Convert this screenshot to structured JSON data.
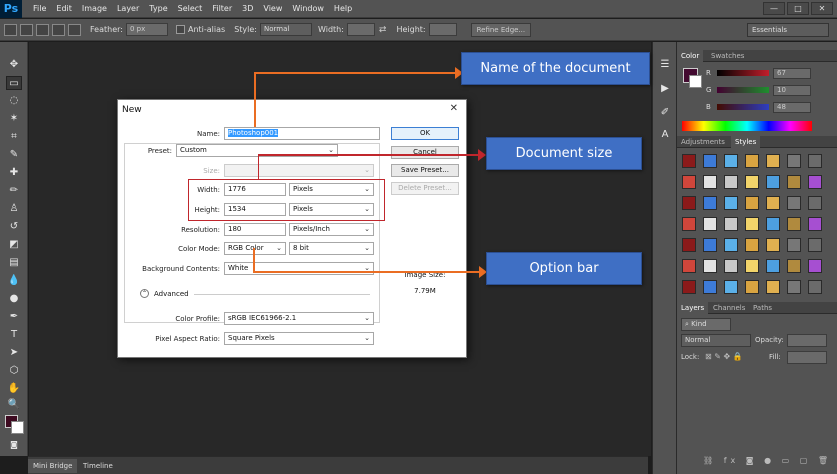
{
  "app": {
    "logo": "Ps",
    "menus": [
      "File",
      "Edit",
      "Image",
      "Layer",
      "Type",
      "Select",
      "Filter",
      "3D",
      "View",
      "Window",
      "Help"
    ],
    "window_controls": [
      "—",
      "□",
      "✕"
    ]
  },
  "options_bar": {
    "feather_label": "Feather:",
    "feather_value": "0 px",
    "antialias_label": "Anti-alias",
    "style_label": "Style:",
    "style_value": "Normal",
    "width_label": "Width:",
    "height_label": "Height:",
    "refine_label": "Refine Edge...",
    "workspace": "Essentials"
  },
  "bottom_tabs": [
    "Mini Bridge",
    "Timeline"
  ],
  "color_panel": {
    "tabs": [
      "Color",
      "Swatches"
    ],
    "channels": [
      {
        "label": "R",
        "value": "67",
        "color": "#c21e2b"
      },
      {
        "label": "G",
        "value": "10",
        "color": "#1e8f2e"
      },
      {
        "label": "B",
        "value": "48",
        "color": "#2d3ec1"
      }
    ],
    "fg": "#430a30"
  },
  "styles_panel": {
    "tabs": [
      "Adjustments",
      "Styles"
    ]
  },
  "layers_panel": {
    "tabs": [
      "Layers",
      "Channels",
      "Paths"
    ],
    "kind_label": "Kind",
    "blend_mode": "Normal",
    "opacity_label": "Opacity:",
    "lock_label": "Lock:",
    "fill_label": "Fill:"
  },
  "dialog": {
    "title": "New",
    "close": "✕",
    "name_label": "Name:",
    "name_value": "Photoshop001",
    "preset_label": "Preset:",
    "preset_value": "Custom",
    "size_label": "Size:",
    "width_label": "Width:",
    "width_value": "1776",
    "width_unit": "Pixels",
    "height_label": "Height:",
    "height_value": "1534",
    "height_unit": "Pixels",
    "resolution_label": "Resolution:",
    "resolution_value": "180",
    "resolution_unit": "Pixels/Inch",
    "color_mode_label": "Color Mode:",
    "color_mode_value": "RGB Color",
    "bit_depth": "8 bit",
    "bg_label": "Background Contents:",
    "bg_value": "White",
    "advanced_label": "Advanced",
    "profile_label": "Color Profile:",
    "profile_value": "sRGB IEC61966-2.1",
    "aspect_label": "Pixel Aspect Ratio:",
    "aspect_value": "Square Pixels",
    "ok": "OK",
    "cancel": "Cancel",
    "save_preset": "Save Preset...",
    "delete_preset": "Delete Preset...",
    "image_size_label": "Image Size:",
    "image_size_value": "7.79M"
  },
  "callouts": {
    "name": "Name of the document",
    "size": "Document size",
    "option": "Option bar"
  }
}
